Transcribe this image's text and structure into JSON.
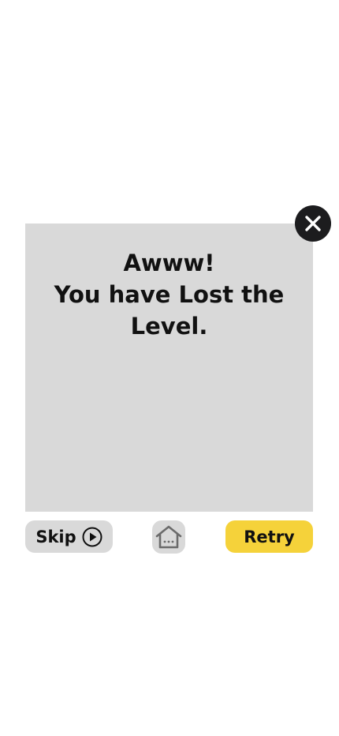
{
  "dialog": {
    "title_line1": "Awww!",
    "title_line2": "You have Lost the",
    "title_line3": "Level."
  },
  "actions": {
    "skip_label": "Skip",
    "retry_label": "Retry"
  },
  "icons": {
    "close": "close-icon",
    "skip": "play-circle-icon",
    "home": "home-icon"
  },
  "colors": {
    "dialog_background": "#d9d9d9",
    "retry_button": "#f5d23a",
    "close_button": "#1c1c1e"
  }
}
